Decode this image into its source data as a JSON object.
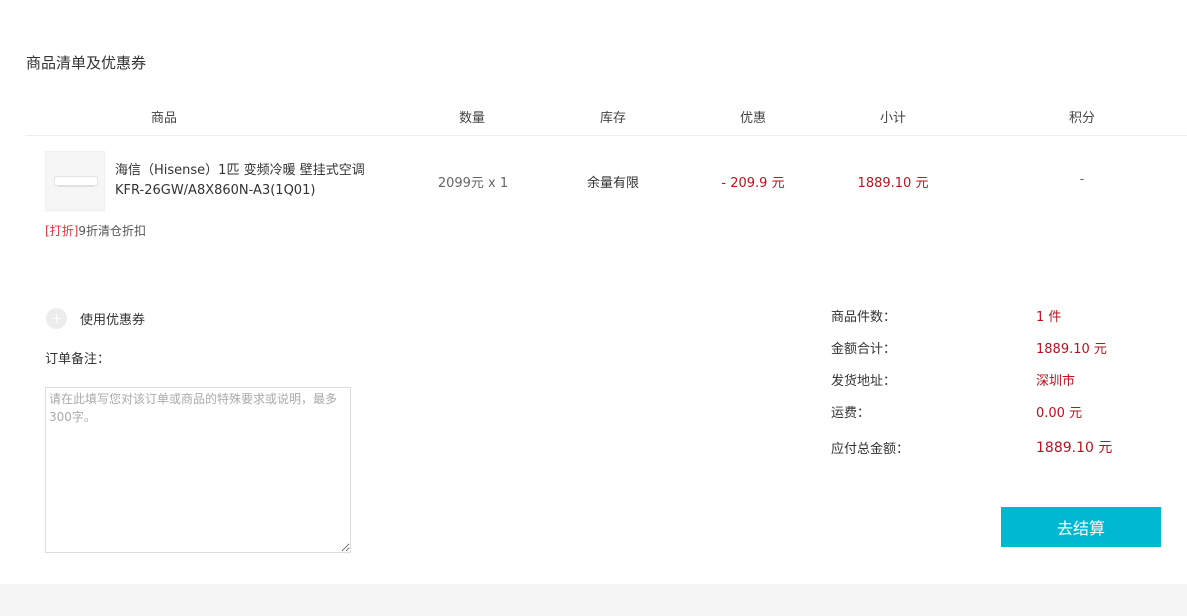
{
  "section_title": "商品清单及优惠券",
  "table": {
    "headers": [
      "商品",
      "数量",
      "库存",
      "优惠",
      "小计",
      "积分"
    ]
  },
  "item": {
    "name": "海信（Hisense）1匹 变频冷暖 壁挂式空调 KFR-26GW/A8X860N-A3(1Q01)",
    "quantity": "2099元 x 1",
    "stock": "余量有限",
    "discount": "- 209.9 元",
    "subtotal": "1889.10 元",
    "points": "-",
    "promo_tag": "[打折]",
    "promo_text": "9折清仓折扣"
  },
  "coupon_label": "使用优惠券",
  "remark": {
    "label": "订单备注：",
    "placeholder": "请在此填写您对该订单或商品的特殊要求或说明，最多300字。"
  },
  "summary": {
    "count_label": "商品件数：",
    "count_value": "1 件",
    "total_label": "金额合计：",
    "total_value": "1889.10 元",
    "ship_from_label": "发货地址：",
    "ship_from_value": "深圳市",
    "freight_label": "运费：",
    "freight_value": "0.00 元",
    "payable_label": "应付总金额：",
    "payable_value": "1889.10 元"
  },
  "checkout_label": "去结算",
  "colors": {
    "accent": "#00b8d2",
    "price": "#b8131f",
    "promo_tag": "#e4393c"
  }
}
